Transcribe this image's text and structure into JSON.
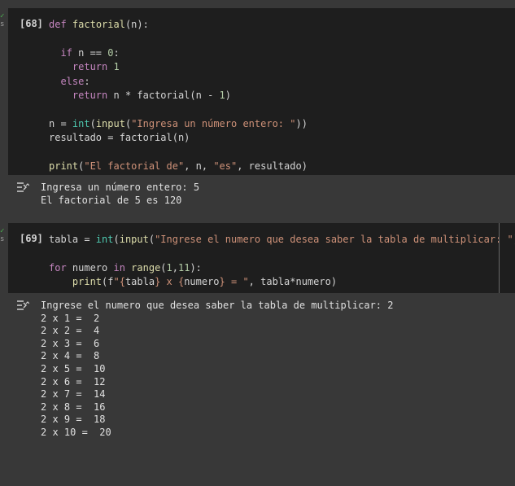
{
  "cell1": {
    "count": "[68]",
    "lines": [
      [
        {
          "t": "def",
          "c": "kw"
        },
        {
          "t": " ",
          "c": "op"
        },
        {
          "t": "factorial",
          "c": "fn"
        },
        {
          "t": "(n):",
          "c": "op"
        }
      ],
      [],
      [
        {
          "t": "  ",
          "c": "op"
        },
        {
          "t": "if",
          "c": "kw"
        },
        {
          "t": " n == ",
          "c": "op"
        },
        {
          "t": "0",
          "c": "num"
        },
        {
          "t": ":",
          "c": "op"
        }
      ],
      [
        {
          "t": "    ",
          "c": "op"
        },
        {
          "t": "return",
          "c": "kw"
        },
        {
          "t": " ",
          "c": "op"
        },
        {
          "t": "1",
          "c": "num"
        }
      ],
      [
        {
          "t": "  ",
          "c": "op"
        },
        {
          "t": "else",
          "c": "kw"
        },
        {
          "t": ":",
          "c": "op"
        }
      ],
      [
        {
          "t": "    ",
          "c": "op"
        },
        {
          "t": "return",
          "c": "kw"
        },
        {
          "t": " n * factorial(n - ",
          "c": "op"
        },
        {
          "t": "1",
          "c": "num"
        },
        {
          "t": ")",
          "c": "op"
        }
      ],
      [],
      [
        {
          "t": "n = ",
          "c": "op"
        },
        {
          "t": "int",
          "c": "bi"
        },
        {
          "t": "(",
          "c": "op"
        },
        {
          "t": "input",
          "c": "fn"
        },
        {
          "t": "(",
          "c": "op"
        },
        {
          "t": "\"Ingresa un número entero: \"",
          "c": "str"
        },
        {
          "t": "))",
          "c": "op"
        }
      ],
      [
        {
          "t": "resultado = factorial(n)",
          "c": "op"
        }
      ],
      [],
      [
        {
          "t": "print",
          "c": "fn"
        },
        {
          "t": "(",
          "c": "op"
        },
        {
          "t": "\"El factorial de\"",
          "c": "str"
        },
        {
          "t": ", n, ",
          "c": "op"
        },
        {
          "t": "\"es\"",
          "c": "str"
        },
        {
          "t": ", resultado)",
          "c": "op"
        }
      ]
    ]
  },
  "output1": {
    "lines": [
      "Ingresa un número entero: 5",
      "El factorial de 5 es 120"
    ]
  },
  "cell2": {
    "count": "[69]",
    "lines": [
      [
        {
          "t": "tabla = ",
          "c": "op"
        },
        {
          "t": "int",
          "c": "bi"
        },
        {
          "t": "(",
          "c": "op"
        },
        {
          "t": "input",
          "c": "fn"
        },
        {
          "t": "(",
          "c": "op"
        },
        {
          "t": "\"Ingrese el numero que desea saber la tabla de multiplicar: \"",
          "c": "str"
        },
        {
          "t": "))",
          "c": "op"
        }
      ],
      [],
      [
        {
          "t": "for",
          "c": "kw"
        },
        {
          "t": " numero ",
          "c": "op"
        },
        {
          "t": "in",
          "c": "kw"
        },
        {
          "t": " ",
          "c": "op"
        },
        {
          "t": "range",
          "c": "fn"
        },
        {
          "t": "(",
          "c": "op"
        },
        {
          "t": "1",
          "c": "num"
        },
        {
          "t": ",",
          "c": "op"
        },
        {
          "t": "11",
          "c": "num"
        },
        {
          "t": "):",
          "c": "op"
        }
      ],
      [
        {
          "t": "    ",
          "c": "op"
        },
        {
          "t": "print",
          "c": "fn"
        },
        {
          "t": "(f",
          "c": "op"
        },
        {
          "t": "\"{",
          "c": "str"
        },
        {
          "t": "tabla",
          "c": "op"
        },
        {
          "t": "} x {",
          "c": "str"
        },
        {
          "t": "numero",
          "c": "op"
        },
        {
          "t": "} = \"",
          "c": "str"
        },
        {
          "t": ", tabla*numero)",
          "c": "op"
        }
      ]
    ]
  },
  "output2": {
    "lines": [
      "Ingrese el numero que desea saber la tabla de multiplicar: 2",
      "2 x 1 =  2",
      "2 x 2 =  4",
      "2 x 3 =  6",
      "2 x 4 =  8",
      "2 x 5 =  10",
      "2 x 6 =  12",
      "2 x 7 =  14",
      "2 x 8 =  16",
      "2 x 9 =  18",
      "2 x 10 =  20"
    ]
  },
  "status_check": "✓",
  "status_s": "s",
  "colors": {
    "code_bg": "#1e1e1e",
    "page_bg": "#383838",
    "keyword": "#c586c0",
    "string": "#ce9178",
    "number": "#b5cea8",
    "function": "#dcdcaa",
    "builtin": "#4ec9b0"
  }
}
